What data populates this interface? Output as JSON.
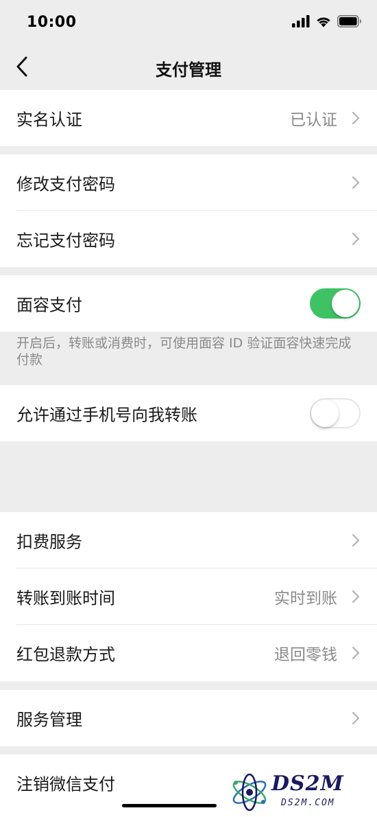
{
  "status_bar": {
    "time": "10:00"
  },
  "nav": {
    "title": "支付管理",
    "back_icon": "chevron-left-icon"
  },
  "groups": {
    "real_name": {
      "label": "实名认证",
      "value": "已认证"
    },
    "change_password": {
      "label": "修改支付密码"
    },
    "forgot_password": {
      "label": "忘记支付密码"
    },
    "face_pay": {
      "label": "面容支付",
      "enabled": true,
      "hint": "开启后，转账或消费时，可使用面容 ID 验证面容快速完成付款"
    },
    "phone_transfer": {
      "label": "允许通过手机号向我转账",
      "enabled": false
    },
    "deduction": {
      "label": "扣费服务"
    },
    "transfer_time": {
      "label": "转账到账时间",
      "value": "实时到账"
    },
    "red_packet_refund": {
      "label": "红包退款方式",
      "value": "退回零钱"
    },
    "service_mgmt": {
      "label": "服务管理"
    },
    "cancel_pay": {
      "label": "注销微信支付"
    }
  },
  "watermark": {
    "brand": "DS2M",
    "domain": "DS2M.COM"
  },
  "colors": {
    "toggle_on": "#3fc264",
    "background": "#ededed",
    "secondary_text": "#8a8a8a"
  }
}
